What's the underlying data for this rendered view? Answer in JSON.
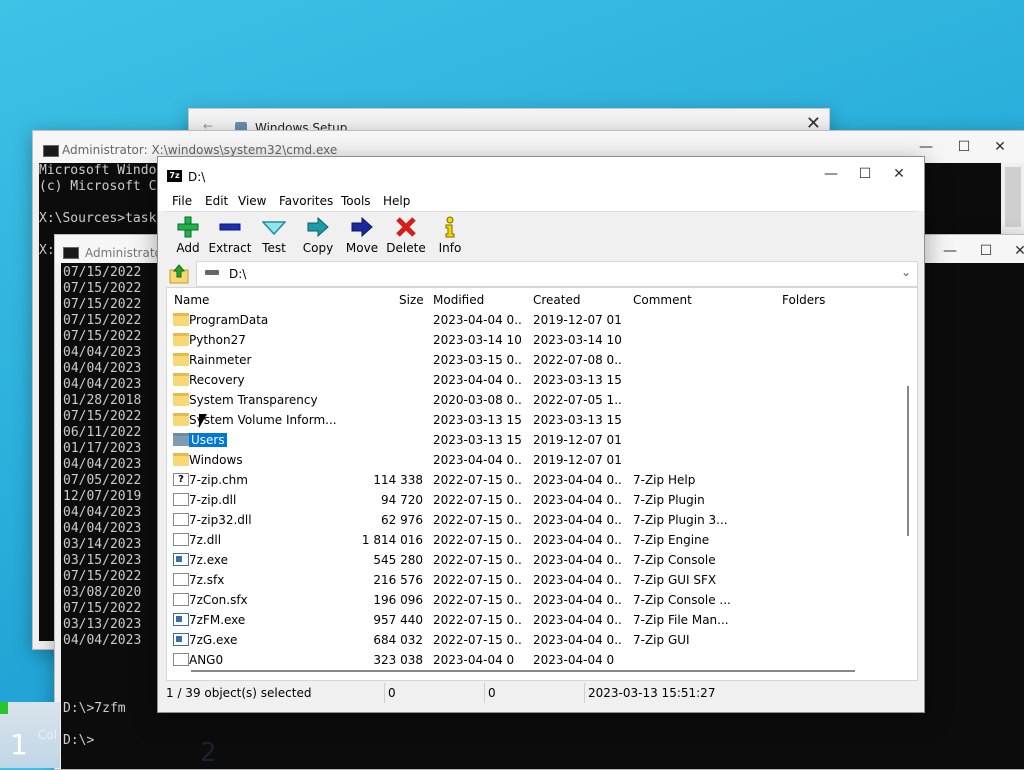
{
  "setup_window": {
    "title": "Windows Setup"
  },
  "cmd1": {
    "title": "Administrator: X:\\windows\\system32\\cmd.exe",
    "lines": [
      "Microsoft Windo",
      "(c) Microsoft C",
      "",
      "X:\\Sources>task",
      "",
      "X:"
    ]
  },
  "cmd2": {
    "title": "Administrator",
    "dates": [
      "07/15/2022",
      "07/15/2022",
      "07/15/2022",
      "07/15/2022",
      "07/15/2022",
      "04/04/2023",
      "04/04/2023",
      "04/04/2023",
      "01/28/2018",
      "07/15/2022",
      "06/11/2022",
      "01/17/2023",
      "04/04/2023",
      "07/05/2022",
      "12/07/2019",
      "04/04/2023",
      "04/04/2023",
      "03/14/2023",
      "03/15/2023",
      "07/15/2022",
      "03/08/2020",
      "07/15/2022",
      "03/13/2023",
      "04/04/2023"
    ],
    "prompt1": "D:\\>7zfm",
    "prompt2": "D:\\>"
  },
  "bottom": {
    "step_one": "1",
    "step_one_label": "Col",
    "step_two": "2"
  },
  "zip": {
    "title": "D:\\",
    "menu": [
      "File",
      "Edit",
      "View",
      "Favorites",
      "Tools",
      "Help"
    ],
    "toolbar": [
      {
        "label": "Add",
        "icon": "plus-icon",
        "color": "#22b14c"
      },
      {
        "label": "Extract",
        "icon": "minus-icon",
        "color": "#1f2fb5"
      },
      {
        "label": "Test",
        "icon": "check-icon",
        "color": "#1fb5c0"
      },
      {
        "label": "Copy",
        "icon": "copy-arrow-icon",
        "color": "#1b9aa8"
      },
      {
        "label": "Move",
        "icon": "move-arrow-icon",
        "color": "#1a2a9e"
      },
      {
        "label": "Delete",
        "icon": "x-icon",
        "color": "#d41e1e"
      },
      {
        "label": "Info",
        "icon": "info-icon",
        "color": "#e0c400"
      }
    ],
    "address": "D:\\",
    "columns": {
      "name": "Name",
      "size": "Size",
      "modified": "Modified",
      "created": "Created",
      "comment": "Comment",
      "folders": "Folders"
    },
    "rows": [
      {
        "name": "ProgramData",
        "size": "",
        "modified": "2023-04-04 0...",
        "created": "2019-12-07 01...",
        "comment": "",
        "type": "folder"
      },
      {
        "name": "Python27",
        "size": "",
        "modified": "2023-03-14 10...",
        "created": "2023-03-14 10...",
        "comment": "",
        "type": "folder"
      },
      {
        "name": "Rainmeter",
        "size": "",
        "modified": "2023-03-15 0...",
        "created": "2022-07-08 0...",
        "comment": "",
        "type": "folder"
      },
      {
        "name": "Recovery",
        "size": "",
        "modified": "2023-04-04 0...",
        "created": "2023-03-13 15...",
        "comment": "",
        "type": "folder"
      },
      {
        "name": "System Transparency",
        "size": "",
        "modified": "2020-03-08 0...",
        "created": "2022-07-05 1...",
        "comment": "",
        "type": "folder"
      },
      {
        "name": "System Volume Inform...",
        "size": "",
        "modified": "2023-03-13 15...",
        "created": "2023-03-13 15...",
        "comment": "",
        "type": "folder"
      },
      {
        "name": "Users",
        "size": "",
        "modified": "2023-03-13 15...",
        "created": "2019-12-07 01...",
        "comment": "",
        "type": "folder-sel"
      },
      {
        "name": "Windows",
        "size": "",
        "modified": "2023-04-04 0...",
        "created": "2019-12-07 01...",
        "comment": "",
        "type": "folder"
      },
      {
        "name": "7-zip.chm",
        "size": "114 338",
        "modified": "2022-07-15 0...",
        "created": "2023-04-04 0...",
        "comment": "7-Zip Help",
        "type": "help"
      },
      {
        "name": "7-zip.dll",
        "size": "94 720",
        "modified": "2022-07-15 0...",
        "created": "2023-04-04 0...",
        "comment": "7-Zip Plugin",
        "type": "doc"
      },
      {
        "name": "7-zip32.dll",
        "size": "62 976",
        "modified": "2022-07-15 0...",
        "created": "2023-04-04 0...",
        "comment": "7-Zip Plugin 3...",
        "type": "doc"
      },
      {
        "name": "7z.dll",
        "size": "1 814 016",
        "modified": "2022-07-15 0...",
        "created": "2023-04-04 0...",
        "comment": "7-Zip Engine",
        "type": "doc"
      },
      {
        "name": "7z.exe",
        "size": "545 280",
        "modified": "2022-07-15 0...",
        "created": "2023-04-04 0...",
        "comment": "7-Zip Console",
        "type": "exe"
      },
      {
        "name": "7z.sfx",
        "size": "216 576",
        "modified": "2022-07-15 0...",
        "created": "2023-04-04 0...",
        "comment": "7-Zip GUI SFX",
        "type": "doc"
      },
      {
        "name": "7zCon.sfx",
        "size": "196 096",
        "modified": "2022-07-15 0...",
        "created": "2023-04-04 0...",
        "comment": "7-Zip Console ...",
        "type": "doc"
      },
      {
        "name": "7zFM.exe",
        "size": "957 440",
        "modified": "2022-07-15 0...",
        "created": "2023-04-04 0...",
        "comment": "7-Zip File Man...",
        "type": "exe"
      },
      {
        "name": "7zG.exe",
        "size": "684 032",
        "modified": "2022-07-15 0...",
        "created": "2023-04-04 0...",
        "comment": "7-Zip GUI",
        "type": "exe"
      },
      {
        "name": "ANG0",
        "size": "323 038",
        "modified": "2023-04-04 0",
        "created": "2023-04-04 0",
        "comment": "",
        "type": "doc"
      }
    ],
    "status": {
      "selected": "1 / 39 object(s) selected",
      "size": "0",
      "packed": "0",
      "date": "2023-03-13 15:51:27"
    }
  }
}
